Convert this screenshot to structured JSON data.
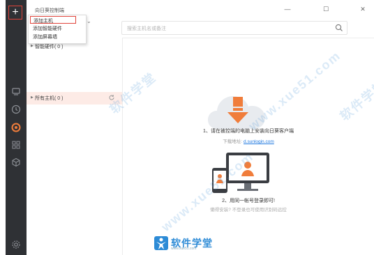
{
  "app": {
    "title": "向日葵控制端"
  },
  "window_controls": {
    "minimize": "—",
    "maximize": "☐",
    "close": "✕"
  },
  "search": {
    "placeholder": "搜索主机名或备注"
  },
  "add_menu": {
    "items": [
      {
        "label": "添加主机"
      },
      {
        "label": "添加智能硬件"
      },
      {
        "label": "添加屏幕墙"
      }
    ]
  },
  "groups": {
    "smart_hardware": "智能硬件( 0 )",
    "all_hosts": "所有主机( 0 )"
  },
  "empty_state": {
    "step1": "1、请在被控端的电脑上安装向日葵客户端",
    "download_label": "下载地址:",
    "download_link": "d.sunlogin.com",
    "step2": "2、用同一帐号登录即可!",
    "hint": "懒得安装? 不登录也可使用识别码远控"
  },
  "watermark": {
    "site_text": "软件学堂",
    "url_text": "www.xue51.com"
  },
  "colors": {
    "accent": "#f07d3b",
    "highlight_border": "#e0433a",
    "rail": "#2f3135",
    "link": "#1e78e0",
    "selected_row": "#fdebe6"
  }
}
